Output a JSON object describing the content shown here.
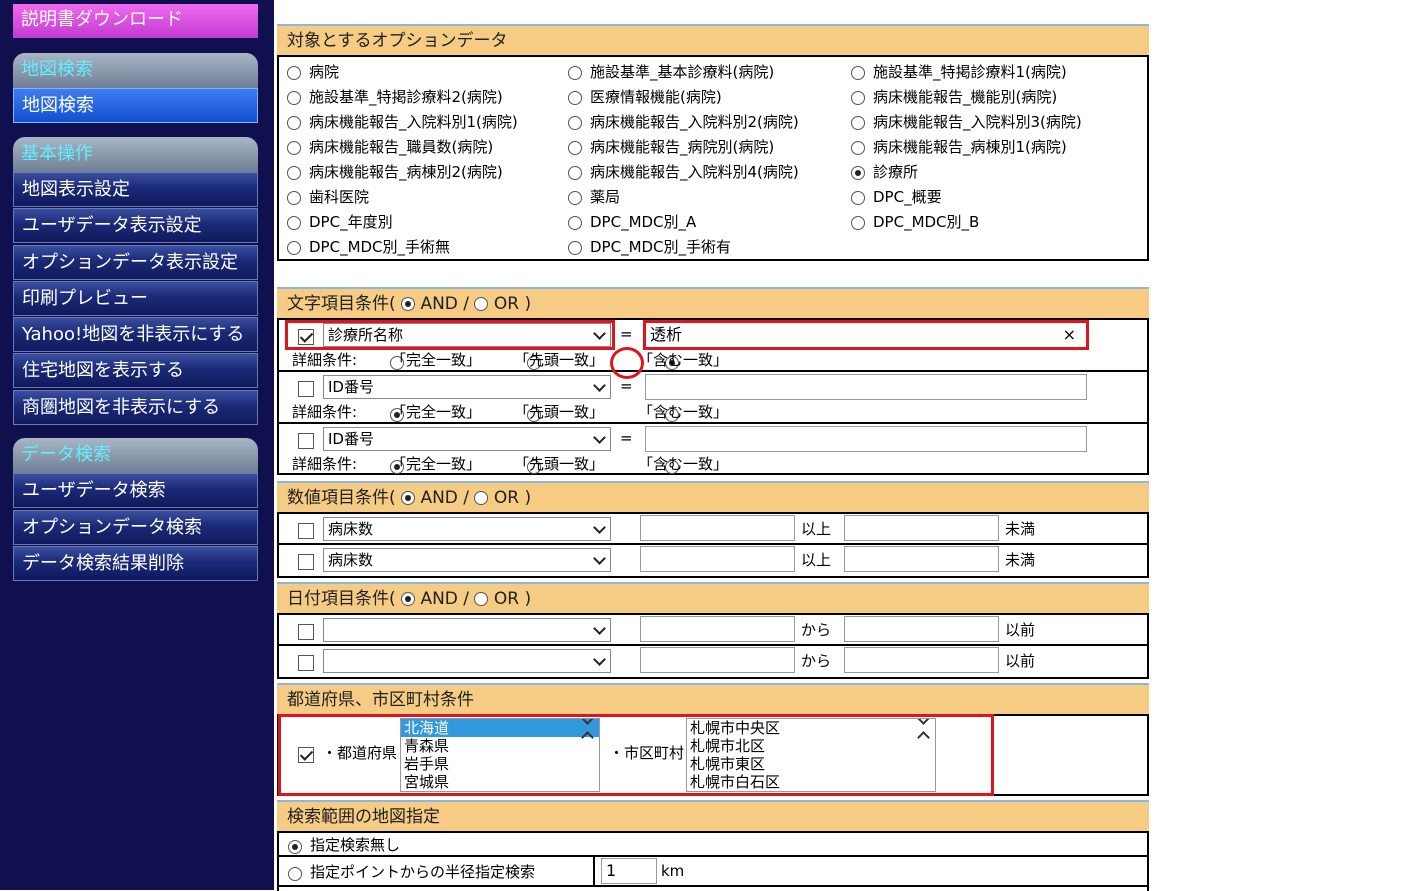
{
  "sidebar": {
    "download": "説明書ダウンロード",
    "sec_map": "地図検索",
    "map_search": "地図検索",
    "sec_basic": "基本操作",
    "basic_items": [
      "地図表示設定",
      "ユーザデータ表示設定",
      "オプションデータ表示設定",
      "印刷プレビュー",
      "Yahoo!地図を非表示にする",
      "住宅地図を表示する",
      "商圏地図を非表示にする"
    ],
    "sec_data": "データ検索",
    "data_items": [
      "ユーザデータ検索",
      "オプションデータ検索",
      "データ検索結果削除"
    ]
  },
  "options": {
    "title": "対象とするオプションデータ",
    "items": [
      "病院",
      "施設基準_基本診療料(病院)",
      "施設基準_特掲診療料1(病院)",
      "施設基準_特掲診療料2(病院)",
      "医療情報機能(病院)",
      "病床機能報告_機能別(病院)",
      "病床機能報告_入院料別1(病院)",
      "病床機能報告_入院料別2(病院)",
      "病床機能報告_入院料別3(病院)",
      "病床機能報告_職員数(病院)",
      "病床機能報告_病院別(病院)",
      "病床機能報告_病棟別1(病院)",
      "病床機能報告_病棟別2(病院)",
      "病床機能報告_入院料別4(病院)",
      "診療所",
      "歯科医院",
      "薬局",
      "DPC_概要",
      "DPC_年度別",
      "DPC_MDC別_A",
      "DPC_MDC別_B",
      "DPC_MDC別_手術無",
      "DPC_MDC別_手術有"
    ],
    "selected": "診療所"
  },
  "text_cond": {
    "title": "文字項目条件(",
    "and": "AND",
    "slash": "/",
    "or": "OR",
    "close": ")",
    "eq": "=",
    "detail": "詳細条件:",
    "exact": "「完全一致」",
    "prefix": "「先頭一致」",
    "contains": "「含む一致」",
    "rows": [
      {
        "checked": true,
        "field": "診療所名称",
        "value": "透析",
        "match": "contains"
      },
      {
        "checked": false,
        "field": "ID番号",
        "value": "",
        "match": "exact"
      },
      {
        "checked": false,
        "field": "ID番号",
        "value": "",
        "match": "exact"
      }
    ],
    "clear": "×"
  },
  "num_cond": {
    "title": "数値項目条件(",
    "and": "AND",
    "slash": "/",
    "or": "OR",
    "close": ")",
    "rows": [
      {
        "field": "病床数",
        "from": "以上",
        "to": "未満"
      },
      {
        "field": "病床数",
        "from": "以上",
        "to": "未満"
      }
    ]
  },
  "date_cond": {
    "title": "日付項目条件(",
    "and": "AND",
    "slash": "/",
    "or": "OR",
    "close": ")",
    "rows": [
      {
        "field": "",
        "from": "から",
        "to": "以前"
      },
      {
        "field": "",
        "from": "から",
        "to": "以前"
      }
    ]
  },
  "pref_cond": {
    "title": "都道府県、市区町村条件",
    "pref_label": "・都道府県",
    "prefs": [
      "北海道",
      "青森県",
      "岩手県",
      "宮城県"
    ],
    "city_label": "・市区町村",
    "cities": [
      "札幌市中央区",
      "札幌市北区",
      "札幌市東区",
      "札幌市白石区"
    ]
  },
  "range": {
    "title": "検索範囲の地図指定",
    "opt1": "指定検索無し",
    "opt2": "指定ポイントからの半径指定検索",
    "radius": "1",
    "unit": "km"
  }
}
